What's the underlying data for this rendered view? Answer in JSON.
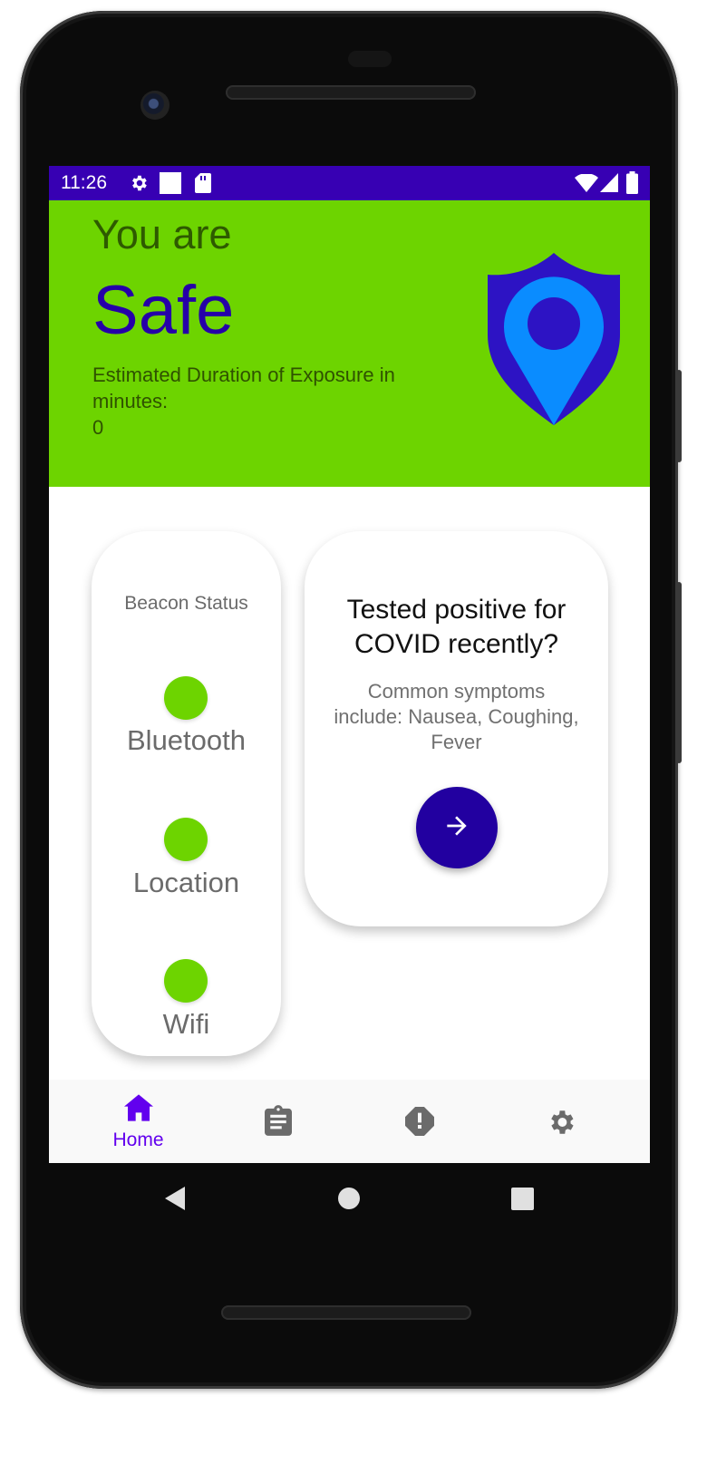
{
  "status_bar": {
    "time": "11:26",
    "left_icons": [
      "gear-icon",
      "square-icon",
      "sd-card-icon"
    ],
    "right_icons": [
      "wifi-icon",
      "signal-icon",
      "battery-icon"
    ],
    "color": "#3700b3"
  },
  "hero": {
    "prefix": "You are",
    "status": "Safe",
    "exposure_label": "Estimated Duration of Exposure in minutes:",
    "exposure_value": "0",
    "background": "#6dd400",
    "icon": "shield-location-icon"
  },
  "beacon_card": {
    "title": "Beacon Status",
    "items": [
      {
        "label": "Bluetooth",
        "status_color": "#6dd400"
      },
      {
        "label": "Location",
        "status_color": "#6dd400"
      },
      {
        "label": "Wifi",
        "status_color": "#6dd400"
      }
    ]
  },
  "covid_card": {
    "title": "Tested positive for COVID recently?",
    "subtitle": "Common symptoms include: Nausea, Coughing, Fever",
    "button_icon": "arrow-right-icon"
  },
  "bottom_nav": {
    "items": [
      {
        "label": "Home",
        "icon": "home-icon",
        "active": true
      },
      {
        "label": "",
        "icon": "clipboard-icon",
        "active": false
      },
      {
        "label": "",
        "icon": "alert-icon",
        "active": false
      },
      {
        "label": "",
        "icon": "gear-icon",
        "active": false
      }
    ],
    "active_color": "#6200ee",
    "inactive_color": "#6b6b6b"
  },
  "system_nav": [
    "back-icon",
    "home-circle-icon",
    "recents-icon"
  ]
}
